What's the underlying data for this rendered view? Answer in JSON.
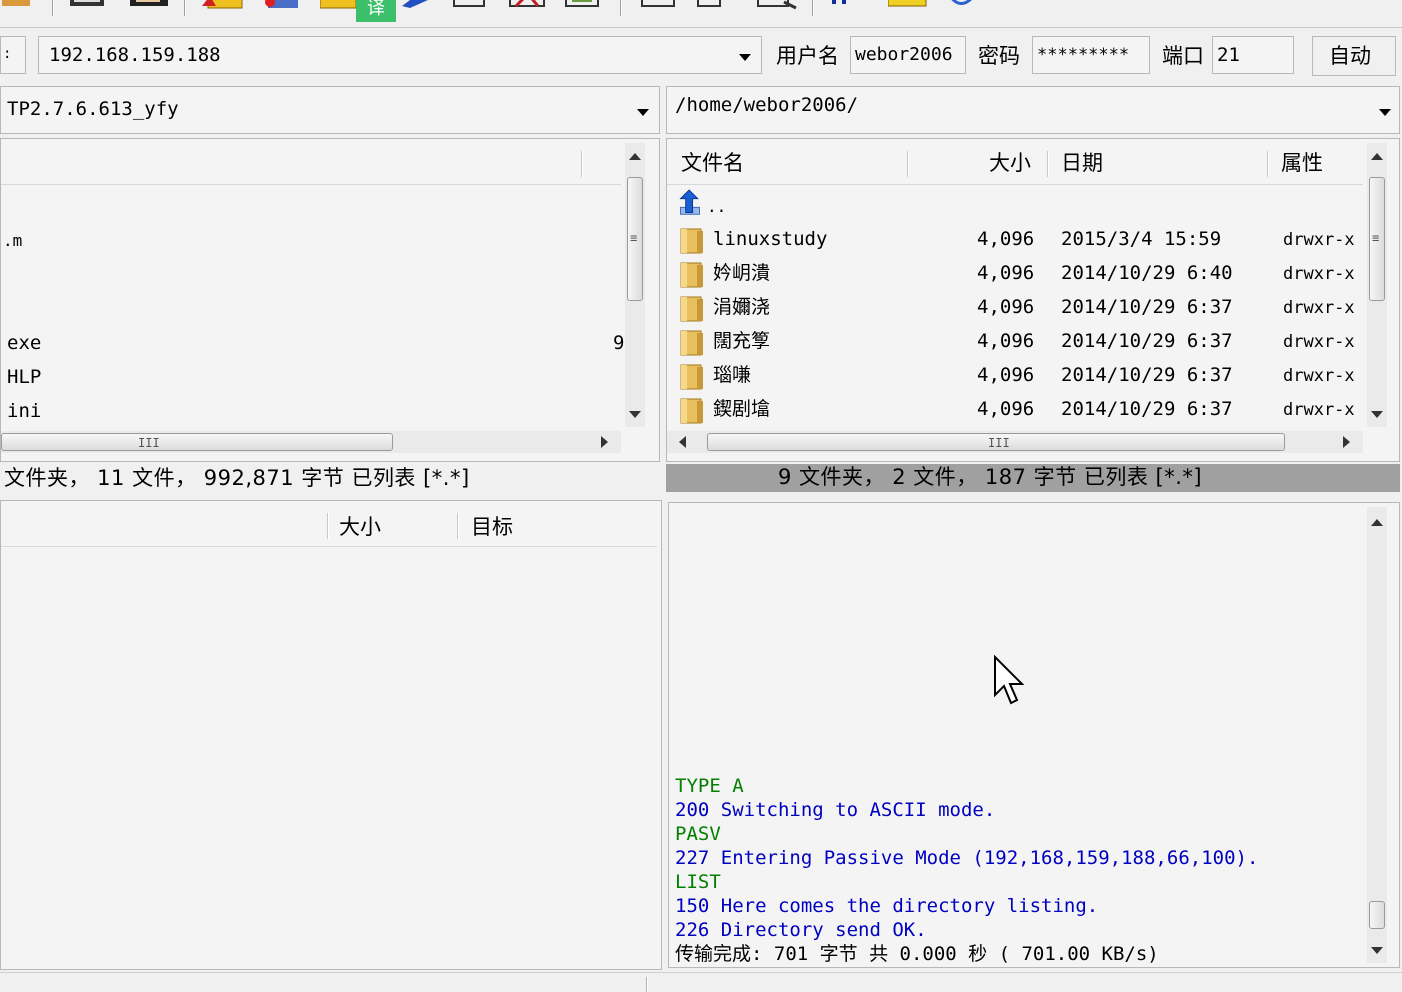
{
  "connection": {
    "host": "192.168.159.188",
    "user_label": "用户名",
    "user": "webor2006",
    "password_label": "密码",
    "password": "*********",
    "port_label": "端口",
    "port": "21",
    "auto_button": "自动"
  },
  "toolbar": {
    "badge": "译"
  },
  "local": {
    "path": "TP2.7.6.613_yfy",
    "files": [
      {
        "name": ".m",
        "size": ""
      },
      {
        "name": "exe",
        "size": "9"
      },
      {
        "name": "HLP",
        "size": ""
      },
      {
        "name": "ini",
        "size": ""
      }
    ],
    "status": "文件夹， 11 文件， 992,871 字节  已列表 [*.*]"
  },
  "remote": {
    "path": "/home/webor2006/",
    "columns": {
      "name": "文件名",
      "size": "大小",
      "date": "日期",
      "attr": "属性"
    },
    "parent": "..",
    "files": [
      {
        "name": "linuxstudy",
        "size": "4,096",
        "date": "2015/3/4 15:59",
        "attr": "drwxr-x"
      },
      {
        "name": "妗岄潰",
        "size": "4,096",
        "date": "2014/10/29 6:40",
        "attr": "drwxr-x"
      },
      {
        "name": "涓嬭浇",
        "size": "4,096",
        "date": "2014/10/29 6:37",
        "attr": "drwxr-x"
      },
      {
        "name": "闊充箰",
        "size": "4,096",
        "date": "2014/10/29 6:37",
        "attr": "drwxr-x"
      },
      {
        "name": "瑙嗛",
        "size": "4,096",
        "date": "2014/10/29 6:37",
        "attr": "drwxr-x"
      },
      {
        "name": "鍥剧墖",
        "size": "4,096",
        "date": "2014/10/29 6:37",
        "attr": "drwxr-x"
      }
    ],
    "status": "9 文件夹， 2 文件， 187 字节  已列表 [*.*]"
  },
  "queue": {
    "columns": {
      "size": "大小",
      "target": "目标"
    }
  },
  "log": {
    "lines": [
      {
        "text": "TYPE A",
        "color": "#008000"
      },
      {
        "text": "200 Switching to ASCII mode.",
        "color": "#0000c0"
      },
      {
        "text": "PASV",
        "color": "#008000"
      },
      {
        "text": "227 Entering Passive Mode (192,168,159,188,66,100).",
        "color": "#0000c0"
      },
      {
        "text": "LIST",
        "color": "#008000"
      },
      {
        "text": "150 Here comes the directory listing.",
        "color": "#0000c0"
      },
      {
        "text": "226 Directory send OK.",
        "color": "#0000c0"
      },
      {
        "text": "传输完成:     701 字节 共  0.000 秒 ( 701.00 KB/s)",
        "color": "#000000"
      }
    ]
  },
  "colors": {
    "status_bar_active": "#a0a0a0",
    "folder": "#e8c060",
    "badge": "#3cbf6a"
  }
}
